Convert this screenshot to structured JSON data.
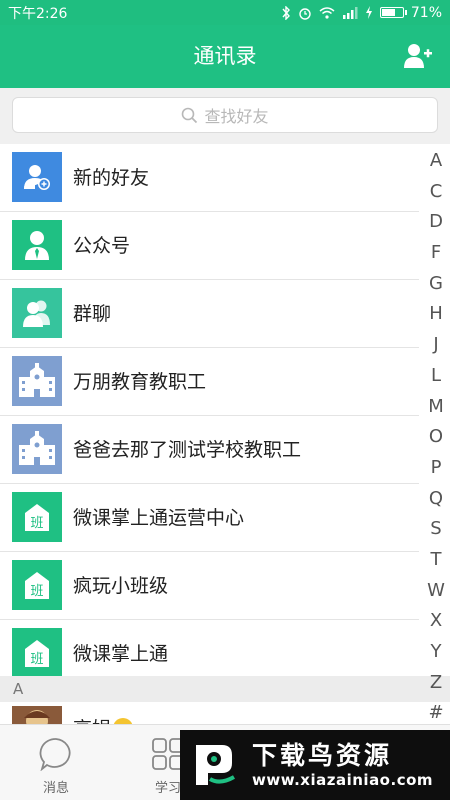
{
  "status": {
    "time": "下午2:26",
    "battery": "71%",
    "battery_level": 0.71
  },
  "header": {
    "title": "通讯录"
  },
  "search": {
    "placeholder": "查找好友"
  },
  "contacts": [
    {
      "label": "新的好友",
      "icon": "new-friend-icon",
      "color": "#3f8ae0"
    },
    {
      "label": "公众号",
      "icon": "official-account-icon",
      "color": "#1fc083"
    },
    {
      "label": "群聊",
      "icon": "group-chat-icon",
      "color": "#36c49d"
    },
    {
      "label": "万朋教育教职工",
      "icon": "school-building-icon",
      "color": "#7f9fd0"
    },
    {
      "label": "爸爸去那了测试学校教职工",
      "icon": "school-building-icon",
      "color": "#7f9fd0"
    },
    {
      "label": "微课掌上通运营中心",
      "icon": "class-icon",
      "color": "#1fc083"
    },
    {
      "label": "疯玩小班级",
      "icon": "class-icon",
      "color": "#1fc083"
    },
    {
      "label": "微课掌上通",
      "icon": "class-icon",
      "color": "#1fc083"
    }
  ],
  "section": {
    "letter": "A"
  },
  "partial_contact": {
    "label": "高娟"
  },
  "index_letters": [
    "A",
    "C",
    "D",
    "F",
    "G",
    "H",
    "J",
    "L",
    "M",
    "O",
    "P",
    "Q",
    "S",
    "T",
    "W",
    "X",
    "Y",
    "Z",
    "#"
  ],
  "bottom_nav": [
    {
      "label": "消息",
      "icon": "chat-bubble-icon"
    },
    {
      "label": "学习",
      "icon": "grid-icon"
    }
  ],
  "watermark": {
    "main": "下载鸟资源",
    "url": "www.xiazainiao.com"
  }
}
